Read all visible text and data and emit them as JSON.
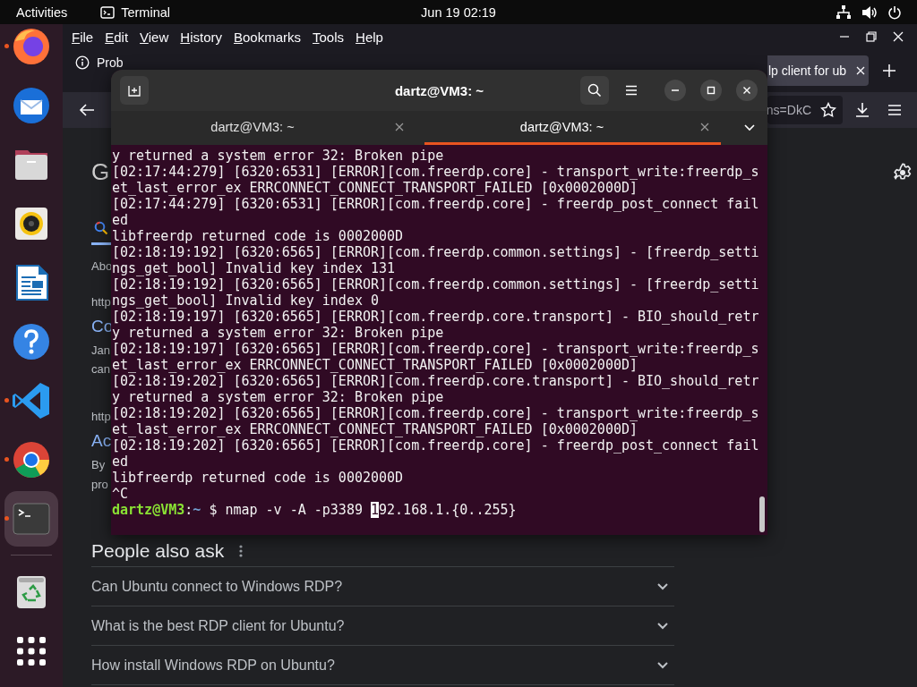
{
  "top_bar": {
    "activities": "Activities",
    "app_name": "Terminal",
    "clock": "Jun 19  02:19"
  },
  "dock": {
    "items": [
      {
        "kind": "firefox",
        "running": true,
        "selected": false
      },
      {
        "kind": "mail",
        "running": false,
        "selected": false
      },
      {
        "kind": "files",
        "running": false,
        "selected": false
      },
      {
        "kind": "music",
        "running": false,
        "selected": false
      },
      {
        "kind": "writer",
        "running": false,
        "selected": false
      },
      {
        "kind": "help",
        "running": false,
        "selected": false
      },
      {
        "kind": "code",
        "running": true,
        "selected": false
      },
      {
        "kind": "chrome",
        "running": true,
        "selected": false
      },
      {
        "kind": "terminal",
        "running": true,
        "selected": true
      },
      {
        "kind": "trash",
        "running": false,
        "selected": false
      },
      {
        "kind": "apps",
        "running": false,
        "selected": false
      }
    ]
  },
  "browser": {
    "menu": [
      "File",
      "Edit",
      "View",
      "History",
      "Bookmarks",
      "Tools",
      "Help"
    ],
    "tabs": [
      {
        "kind": "error_page",
        "label": "Prob",
        "selected": false
      },
      {
        "kind": "search",
        "label": "lp client for ub",
        "selected": true
      }
    ],
    "address": "ns=DkC",
    "page": {
      "logo": "G",
      "snippets": [
        {
          "kind": "text",
          "text": "Abo"
        },
        {
          "kind": "url",
          "text": "http"
        },
        {
          "kind": "title",
          "text": "Co"
        },
        {
          "kind": "text",
          "text": "Jan"
        },
        {
          "kind": "text",
          "text": "can"
        },
        {
          "kind": "url",
          "text": "http"
        },
        {
          "kind": "title",
          "text": "Ac"
        },
        {
          "kind": "text",
          "text": "By"
        },
        {
          "kind": "text",
          "text": "pro"
        }
      ],
      "people_also_ask": {
        "title": "People also ask",
        "questions": [
          "Can Ubuntu connect to Windows RDP?",
          "What is the best RDP client for Ubuntu?",
          "How install Windows RDP on Ubuntu?"
        ]
      }
    }
  },
  "terminal": {
    "title": "dartz@VM3: ~",
    "tabs": [
      {
        "label": "dartz@VM3: ~",
        "selected": false
      },
      {
        "label": "dartz@VM3: ~",
        "selected": true
      }
    ],
    "lines": [
      "y returned a system error 32: Broken pipe",
      "[02:17:44:279] [6320:6531] [ERROR][com.freerdp.core] - transport_write:freerdp_s",
      "et_last_error_ex ERRCONNECT_CONNECT_TRANSPORT_FAILED [0x0002000D]",
      "[02:17:44:279] [6320:6531] [ERROR][com.freerdp.core] - freerdp_post_connect fail",
      "ed",
      "libfreerdp returned code is 0002000D",
      "[02:18:19:192] [6320:6565] [ERROR][com.freerdp.common.settings] - [freerdp_setti",
      "ngs_get_bool] Invalid key index 131",
      "[02:18:19:192] [6320:6565] [ERROR][com.freerdp.common.settings] - [freerdp_setti",
      "ngs_get_bool] Invalid key index 0",
      "[02:18:19:197] [6320:6565] [ERROR][com.freerdp.core.transport] - BIO_should_retr",
      "y returned a system error 32: Broken pipe",
      "[02:18:19:197] [6320:6565] [ERROR][com.freerdp.core] - transport_write:freerdp_s",
      "et_last_error_ex ERRCONNECT_CONNECT_TRANSPORT_FAILED [0x0002000D]",
      "[02:18:19:202] [6320:6565] [ERROR][com.freerdp.core.transport] - BIO_should_retr",
      "y returned a system error 32: Broken pipe",
      "[02:18:19:202] [6320:6565] [ERROR][com.freerdp.core] - transport_write:freerdp_s",
      "et_last_error_ex ERRCONNECT_CONNECT_TRANSPORT_FAILED [0x0002000D]",
      "[02:18:19:202] [6320:6565] [ERROR][com.freerdp.core] - freerdp_post_connect fail",
      "ed",
      "libfreerdp returned code is 0002000D",
      "^C"
    ],
    "prompt": {
      "user_host": "dartz@VM3",
      "separator": ":",
      "path": "~",
      "symbol": "$",
      "command": "nmap -v -A -p3389",
      "cursor_text": "1",
      "after_cursor": "92.168.1.{0..255}"
    }
  }
}
